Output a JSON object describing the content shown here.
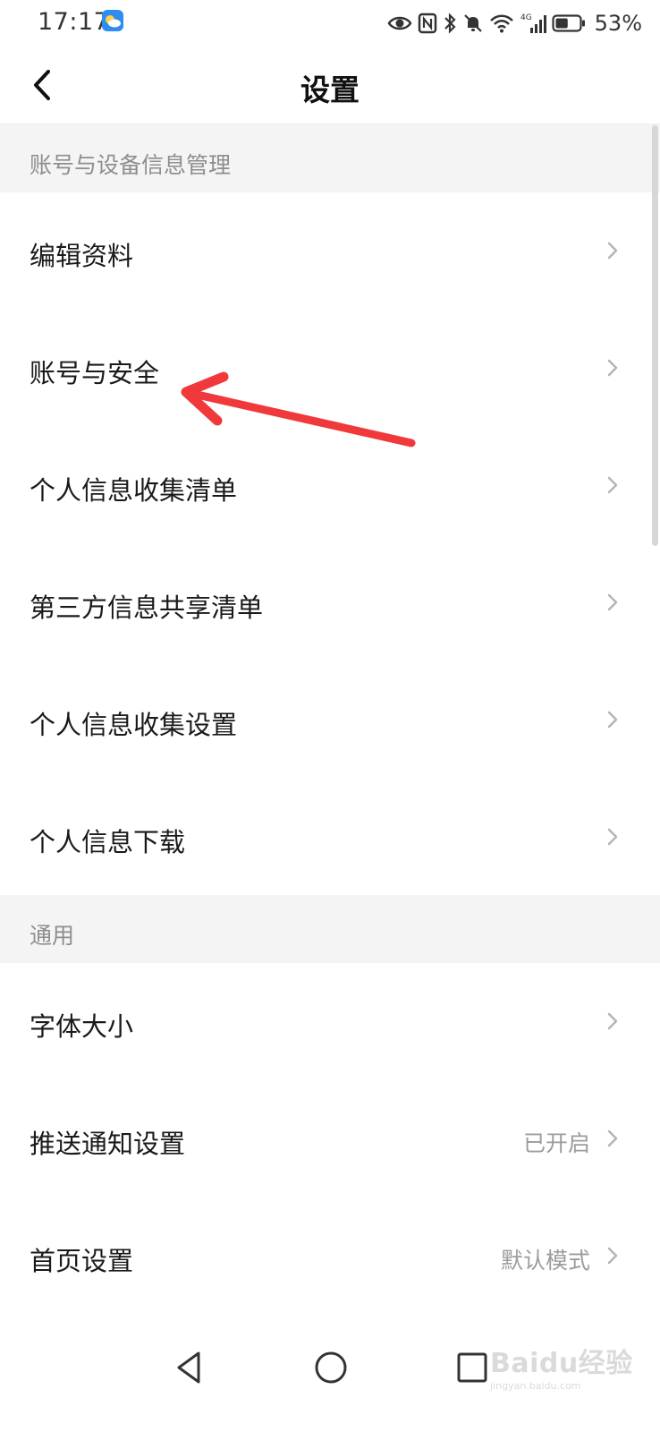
{
  "status_bar": {
    "time": "17:17",
    "battery_percent": "53%",
    "icons": [
      "weather-icon",
      "eye-icon",
      "nfc-icon",
      "bluetooth-icon",
      "mute-icon",
      "wifi-icon",
      "signal-4g-icon",
      "battery-icon"
    ],
    "network_label": "4G",
    "battery_level": 0.53
  },
  "header": {
    "title": "设置",
    "back_icon": "chevron-left-icon"
  },
  "sections": [
    {
      "title": "账号与设备信息管理",
      "items": [
        {
          "label": "编辑资料",
          "value": ""
        },
        {
          "label": "账号与安全",
          "value": ""
        },
        {
          "label": "个人信息收集清单",
          "value": ""
        },
        {
          "label": "第三方信息共享清单",
          "value": ""
        },
        {
          "label": "个人信息收集设置",
          "value": ""
        },
        {
          "label": "个人信息下载",
          "value": ""
        }
      ]
    },
    {
      "title": "通用",
      "items": [
        {
          "label": "字体大小",
          "value": ""
        },
        {
          "label": "推送通知设置",
          "value": "已开启"
        },
        {
          "label": "首页设置",
          "value": "默认模式"
        }
      ]
    }
  ],
  "annotation": {
    "type": "red-arrow",
    "color": "#f0393a",
    "points_to": "账号与安全"
  },
  "nav_bar": {
    "buttons": [
      "back-triangle-icon",
      "home-circle-icon",
      "recents-square-icon"
    ]
  },
  "watermark": {
    "brand": "Baidu经验",
    "url": "jingyan.baidu.com"
  },
  "colors": {
    "section_bg": "#f4f4f4",
    "label_text": "#1a1a1a",
    "secondary_text": "#9c9c9c",
    "weather_icon": "#2f8cf0"
  }
}
